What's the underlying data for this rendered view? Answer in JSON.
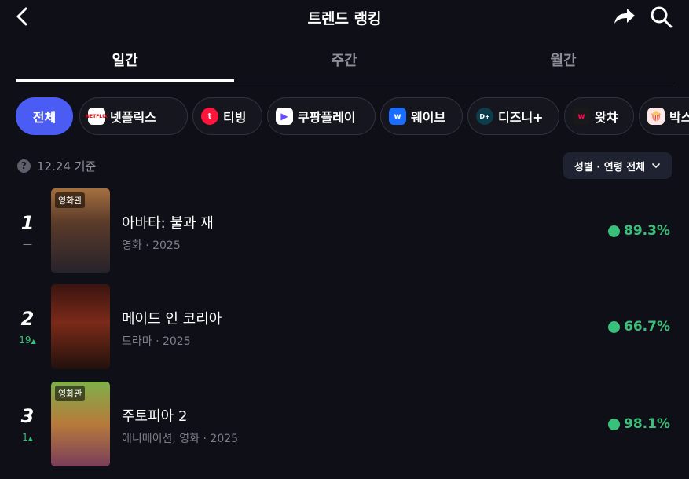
{
  "header": {
    "title": "트렌드 랭킹",
    "back_icon": "chevron-left-icon",
    "share_icon": "share-arrow-icon",
    "search_icon": "search-icon"
  },
  "tabs": [
    {
      "label": "일간",
      "active": true
    },
    {
      "label": "주간",
      "active": false
    },
    {
      "label": "월간",
      "active": false
    }
  ],
  "chips": [
    {
      "label": "전체",
      "active": true,
      "logo": ""
    },
    {
      "label": "넷플릭스",
      "logo_text": "NETFLIX",
      "logo_color": "#e50914"
    },
    {
      "label": "티빙",
      "logo_text": "t",
      "logo_color": "#ff153c"
    },
    {
      "label": "쿠팡플레이",
      "logo_text": "▶",
      "logo_color": "#ffffff"
    },
    {
      "label": "웨이브",
      "logo_text": "w",
      "logo_color": "#1a6dff"
    },
    {
      "label": "디즈니+",
      "logo_text": "D+",
      "logo_color": "#0b3d4a"
    },
    {
      "label": "왓챠",
      "logo_text": "w",
      "logo_color": "#1a1a1a"
    },
    {
      "label": "박스오",
      "logo_text": "🍿",
      "logo_color": "#ffe7e7"
    }
  ],
  "basis": {
    "icon_text": "?",
    "label": "12.24 기준"
  },
  "filter": {
    "label": "성별 · 연령 전체"
  },
  "items": [
    {
      "rank": "1",
      "change": "—",
      "change_dir": "same",
      "badge": "영화관",
      "title": "아바타: 불과 재",
      "meta": "영화 · 2025",
      "score": "89.3%",
      "poster_colors": [
        "#6b4a32",
        "#1b2233"
      ]
    },
    {
      "rank": "2",
      "change": "19",
      "change_dir": "up",
      "badge": "",
      "title": "메이드 인 코리아",
      "meta": "드라마 · 2025",
      "score": "66.7%",
      "poster_colors": [
        "#5a1a12",
        "#1a0f0c"
      ]
    },
    {
      "rank": "3",
      "change": "1",
      "change_dir": "up",
      "badge": "영화관",
      "title": "주토피아 2",
      "meta": "애니메이션, 영화 · 2025",
      "score": "98.1%",
      "poster_colors": [
        "#4f7d3a",
        "#7a5a2a"
      ]
    }
  ]
}
